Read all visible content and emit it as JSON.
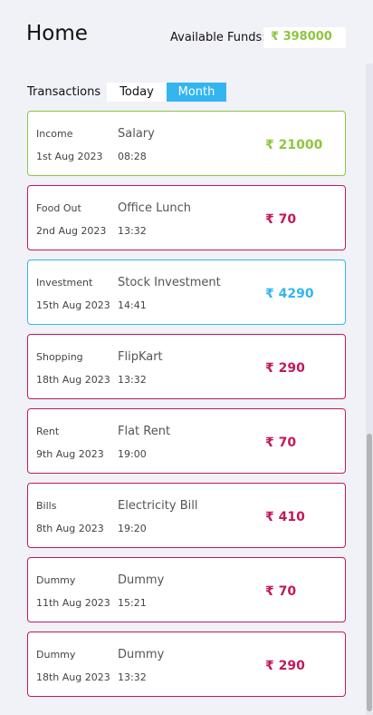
{
  "header": {
    "title": "Home",
    "funds_label": "Available Funds:",
    "funds_value": "₹ 398000"
  },
  "filters": {
    "label": "Transactions",
    "today": "Today",
    "month": "Month",
    "active": "Month"
  },
  "colors": {
    "income": "#8cc63f",
    "expense": "#c2185b",
    "investment": "#33b5f0"
  },
  "transactions": [
    {
      "category": "Income",
      "name": "Salary",
      "date": "1st Aug 2023",
      "time": "08:28",
      "amount": "₹ 21000",
      "kind": "income"
    },
    {
      "category": "Food Out",
      "name": "Office Lunch",
      "date": "2nd Aug 2023",
      "time": "13:32",
      "amount": "₹ 70",
      "kind": "expense"
    },
    {
      "category": "Investment",
      "name": "Stock Investment",
      "date": "15th Aug 2023",
      "time": "14:41",
      "amount": "₹ 4290",
      "kind": "investment"
    },
    {
      "category": "Shopping",
      "name": "FlipKart",
      "date": "18th Aug 2023",
      "time": "13:32",
      "amount": "₹ 290",
      "kind": "expense"
    },
    {
      "category": "Rent",
      "name": "Flat Rent",
      "date": "9th Aug 2023",
      "time": "19:00",
      "amount": "₹ 70",
      "kind": "expense"
    },
    {
      "category": "Bills",
      "name": "Electricity Bill",
      "date": "8th Aug 2023",
      "time": "19:20",
      "amount": "₹ 410",
      "kind": "expense"
    },
    {
      "category": "Dummy",
      "name": "Dummy",
      "date": "11th Aug 2023",
      "time": "15:21",
      "amount": "₹ 70",
      "kind": "expense"
    },
    {
      "category": "Dummy",
      "name": "Dummy",
      "date": "18th Aug 2023",
      "time": "13:32",
      "amount": "₹ 290",
      "kind": "expense"
    }
  ]
}
